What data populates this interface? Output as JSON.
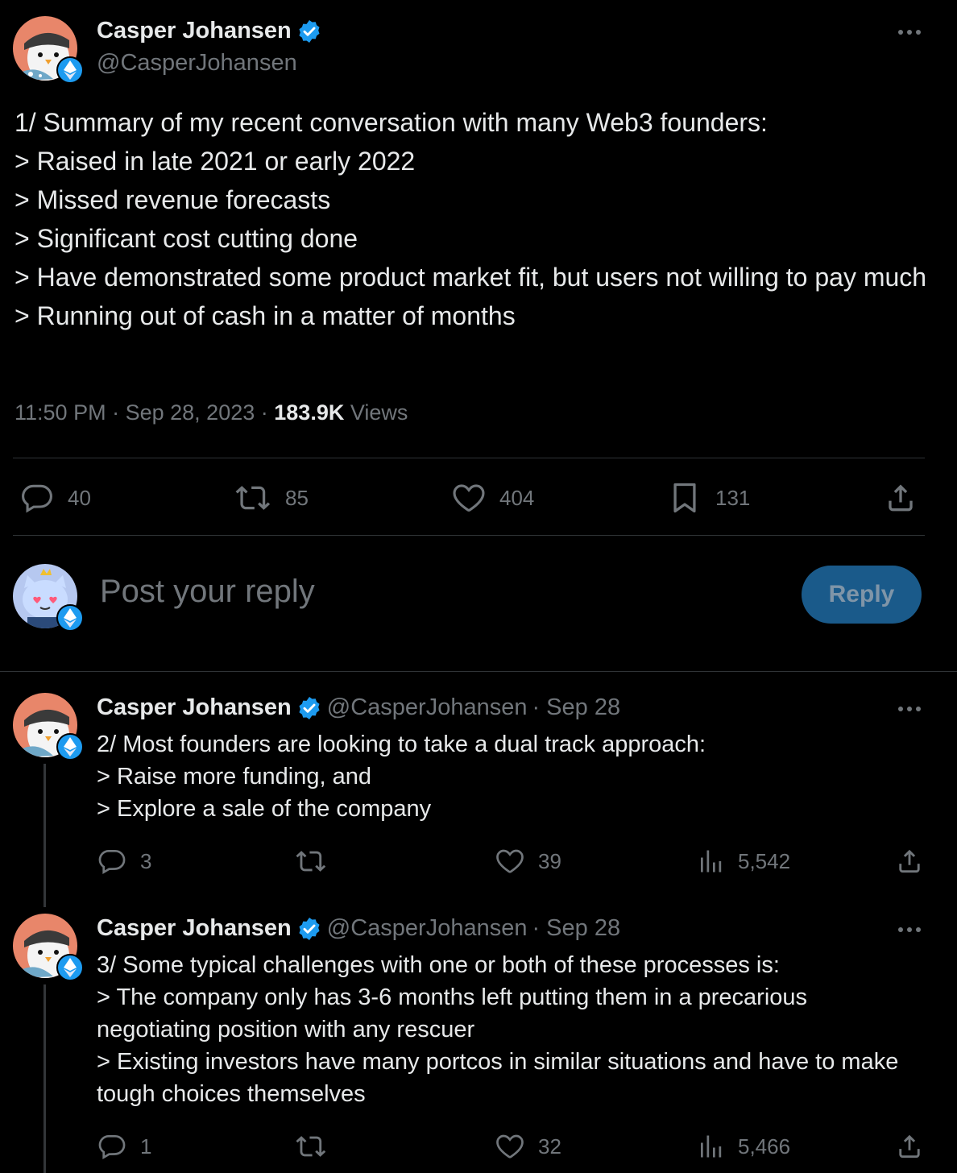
{
  "main_tweet": {
    "author_name": "Casper Johansen",
    "author_handle": "@CasperJohansen",
    "text": "1/ Summary of my recent conversation with many Web3 founders:\n> Raised in late 2021 or early 2022\n> Missed revenue forecasts\n> Significant cost cutting done\n> Have demonstrated some product market fit, but users not willing to pay much\n> Running out of cash in a matter of months",
    "time": "11:50 PM",
    "date": "Sep 28, 2023",
    "views_count": "183.9K",
    "views_label": "Views",
    "replies": "40",
    "reposts": "85",
    "likes": "404",
    "bookmarks": "131"
  },
  "reply_box": {
    "placeholder": "Post your reply",
    "button_label": "Reply"
  },
  "thread": [
    {
      "author_name": "Casper Johansen",
      "author_handle": "@CasperJohansen",
      "date": "· Sep 28",
      "text": "2/ Most founders are looking to take a dual track approach:\n> Raise more funding, and\n> Explore a sale of the company",
      "replies": "3",
      "reposts": "",
      "likes": "39",
      "views": "5,542"
    },
    {
      "author_name": "Casper Johansen",
      "author_handle": "@CasperJohansen",
      "date": "· Sep 28",
      "text": "3/ Some typical challenges with one or both of these processes is:\n> The company only has 3-6 months left putting them in a precarious negotiating position with any rescuer\n> Existing investors have many portcos in similar situations and have to make tough choices themselves",
      "replies": "1",
      "reposts": "",
      "likes": "32",
      "views": "5,466"
    }
  ],
  "colors": {
    "background": "#000000",
    "text_primary": "#e7e9ea",
    "text_secondary": "#71767b",
    "accent": "#1d9bf0",
    "divider": "#2f3336"
  }
}
